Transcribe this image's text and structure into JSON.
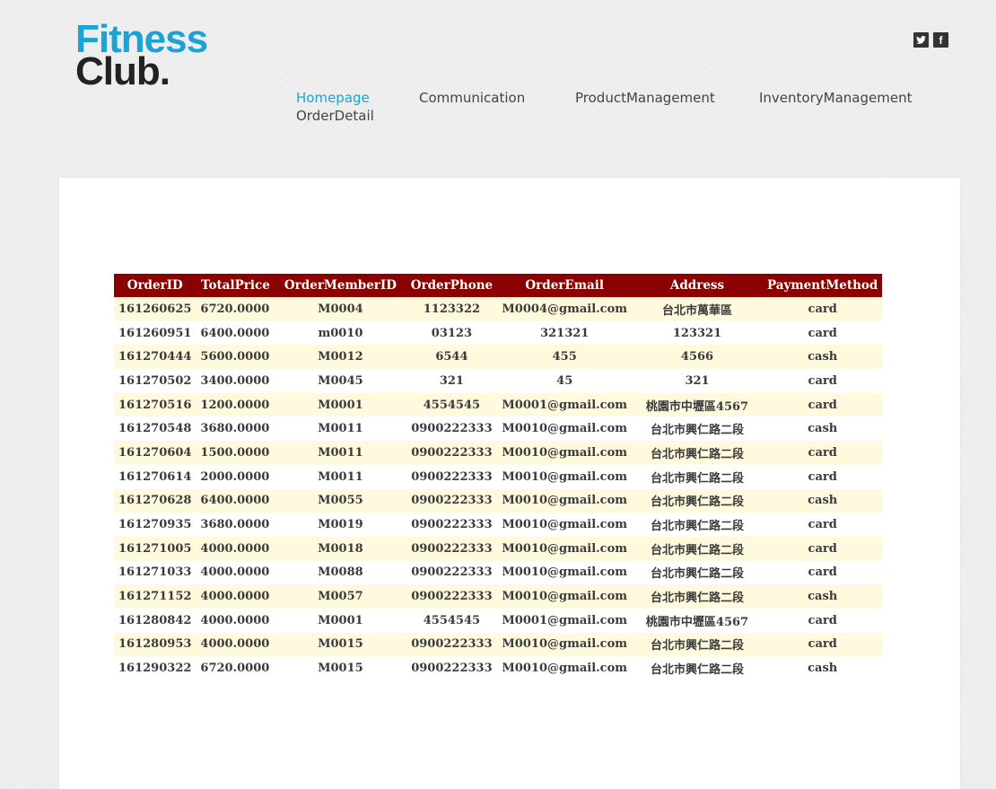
{
  "logo": {
    "line1": "Fitness",
    "line2": "Club."
  },
  "social": {
    "twitter": "twitter-icon",
    "facebook": "facebook-icon",
    "facebook_glyph": "f"
  },
  "nav": {
    "items": [
      {
        "label": "Homepage",
        "active": true
      },
      {
        "label": "Communication",
        "active": false
      },
      {
        "label": "ProductManagement",
        "active": false
      },
      {
        "label": "InventoryManagement",
        "active": false
      },
      {
        "label": "OrderDetail",
        "active": false
      }
    ]
  },
  "colors": {
    "accent": "#1ba3d6",
    "header_bg": "#8b0000",
    "row_alt": "#fffadd"
  },
  "table": {
    "headers": [
      "OrderID",
      "TotalPrice",
      "OrderMemberID",
      "OrderPhone",
      "OrderEmail",
      "Address",
      "PaymentMethod"
    ],
    "rows": [
      [
        "161260625",
        "6720.0000",
        "M0004",
        "1123322",
        "M0004@gmail.com",
        "台北市萬華區",
        "card"
      ],
      [
        "161260951",
        "6400.0000",
        "m0010",
        "03123",
        "321321",
        "123321",
        "card"
      ],
      [
        "161270444",
        "5600.0000",
        "M0012",
        "6544",
        "455",
        "4566",
        "cash"
      ],
      [
        "161270502",
        "3400.0000",
        "M0045",
        "321",
        "45",
        "321",
        "card"
      ],
      [
        "161270516",
        "1200.0000",
        "M0001",
        "4554545",
        "M0001@gmail.com",
        "桃園市中壢區4567",
        "card"
      ],
      [
        "161270548",
        "3680.0000",
        "M0011",
        "0900222333",
        "M0010@gmail.com",
        "台北市興仁路二段",
        "cash"
      ],
      [
        "161270604",
        "1500.0000",
        "M0011",
        "0900222333",
        "M0010@gmail.com",
        "台北市興仁路二段",
        "card"
      ],
      [
        "161270614",
        "2000.0000",
        "M0011",
        "0900222333",
        "M0010@gmail.com",
        "台北市興仁路二段",
        "card"
      ],
      [
        "161270628",
        "6400.0000",
        "M0055",
        "0900222333",
        "M0010@gmail.com",
        "台北市興仁路二段",
        "cash"
      ],
      [
        "161270935",
        "3680.0000",
        "M0019",
        "0900222333",
        "M0010@gmail.com",
        "台北市興仁路二段",
        "card"
      ],
      [
        "161271005",
        "4000.0000",
        "M0018",
        "0900222333",
        "M0010@gmail.com",
        "台北市興仁路二段",
        "card"
      ],
      [
        "161271033",
        "4000.0000",
        "M0088",
        "0900222333",
        "M0010@gmail.com",
        "台北市興仁路二段",
        "card"
      ],
      [
        "161271152",
        "4000.0000",
        "M0057",
        "0900222333",
        "M0010@gmail.com",
        "台北市興仁路二段",
        "cash"
      ],
      [
        "161280842",
        "4000.0000",
        "M0001",
        "4554545",
        "M0001@gmail.com",
        "桃園市中壢區4567",
        "card"
      ],
      [
        "161280953",
        "4000.0000",
        "M0015",
        "0900222333",
        "M0010@gmail.com",
        "台北市興仁路二段",
        "card"
      ],
      [
        "161290322",
        "6720.0000",
        "M0015",
        "0900222333",
        "M0010@gmail.com",
        "台北市興仁路二段",
        "cash"
      ]
    ]
  }
}
